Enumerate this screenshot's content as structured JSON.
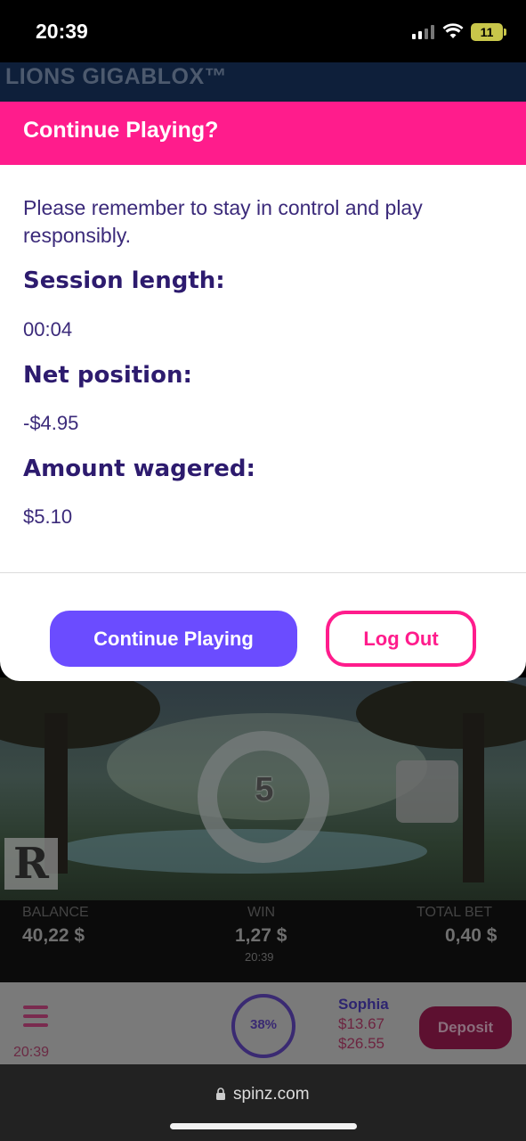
{
  "status_bar": {
    "time": "20:39",
    "battery": "11",
    "icons": [
      "signal-icon",
      "wifi-icon",
      "battery-icon"
    ]
  },
  "game": {
    "title": "LIONS GIGABLOX™",
    "spin_count": "5",
    "logo_letter": "R",
    "balance_label": "BALANCE",
    "balance_value": "40,22 $",
    "win_label": "WIN",
    "win_value": "1,27 $",
    "win_time": "20:39",
    "total_bet_label": "TOTAL BET",
    "total_bet_value": "0,40 $"
  },
  "site_bar": {
    "time": "20:39",
    "progress": "38%",
    "progress_fraction": 0.38,
    "user_name": "Sophia",
    "balance_1": "$13.67",
    "balance_2": "$26.55",
    "deposit_label": "Deposit",
    "icons": [
      "menu-icon"
    ]
  },
  "modal": {
    "title": "Continue Playing?",
    "message": "Please remember to stay in control and play responsibly.",
    "session_length_label": "Session length:",
    "session_length_value": "00:04",
    "net_position_label": "Net position:",
    "net_position_value": "-$4.95",
    "amount_wagered_label": "Amount wagered:",
    "amount_wagered_value": "$5.10",
    "continue_label": "Continue Playing",
    "logout_label": "Log Out"
  },
  "browser": {
    "url": "spinz.com",
    "icons": [
      "lock-icon"
    ]
  },
  "colors": {
    "accent_pink": "#ff1c8c",
    "accent_purple": "#6b4cff",
    "text_purple": "#3b2a7a"
  }
}
